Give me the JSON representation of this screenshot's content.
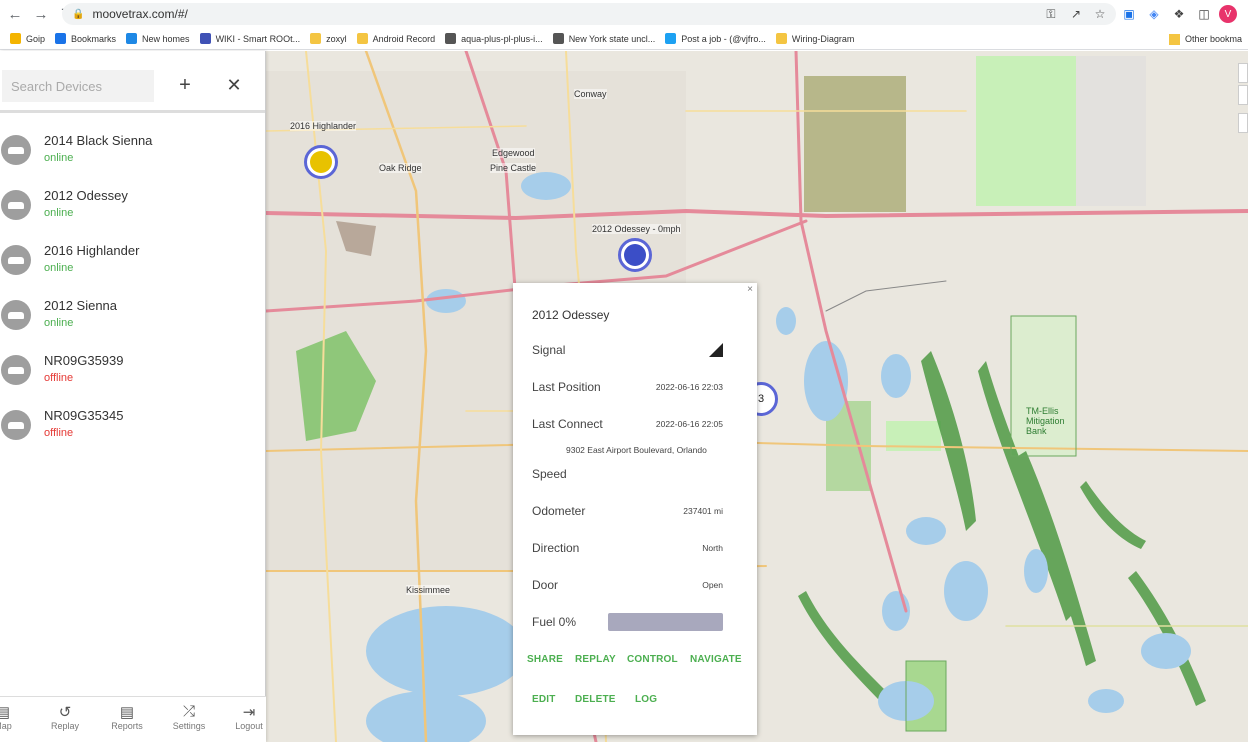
{
  "browser": {
    "url": "moovetrax.com/#/",
    "avatar_letter": "V",
    "bookmarks": [
      {
        "label": "Goip",
        "color": "#f4b400"
      },
      {
        "label": "Bookmarks",
        "color": "#1a73e8"
      },
      {
        "label": "New homes",
        "color": "#1e88e5"
      },
      {
        "label": "WIKI - Smart ROOt...",
        "color": "#3f51b5"
      },
      {
        "label": "zoxyl",
        "color": "#f4c542"
      },
      {
        "label": "Android Record",
        "color": "#f4c542"
      },
      {
        "label": "aqua-plus-pl-plus-i...",
        "color": "#555555"
      },
      {
        "label": "New York state uncl...",
        "color": "#555555"
      },
      {
        "label": "Post a job - (@vjfro...",
        "color": "#1da1f2"
      },
      {
        "label": "Wiring-Diagram",
        "color": "#f4c542"
      }
    ],
    "other_bookmarks": "Other bookma"
  },
  "sidebar": {
    "search_placeholder": "Search Devices",
    "devices": [
      {
        "name": "2014 Black Sienna",
        "status": "online"
      },
      {
        "name": "2012 Odessey",
        "status": "online"
      },
      {
        "name": "2016 Highlander",
        "status": "online"
      },
      {
        "name": "2012 Sienna",
        "status": "online"
      },
      {
        "name": "NR09G35939",
        "status": "offline"
      },
      {
        "name": "NR09G35345",
        "status": "offline"
      }
    ],
    "nav": [
      "Map",
      "Replay",
      "Reports",
      "Settings",
      "Logout"
    ]
  },
  "map": {
    "labels": {
      "highlander_marker": "2016 Highlander",
      "odessey_marker": "2012 Odessey - 0mph",
      "cluster_count": "3",
      "conway": "Conway",
      "oak_ridge": "Oak Ridge",
      "pine_castle": "Pine Castle",
      "kissimmee": "Kissimmee",
      "edgewood": "Edgewood",
      "tm_ellis": "TM-Ellis Mitigation Bank"
    }
  },
  "popup": {
    "title": "2012 Odessey",
    "signal_label": "Signal",
    "last_position_label": "Last Position",
    "last_position_value": "2022-06-16 22:03",
    "last_connect_label": "Last Connect",
    "last_connect_value": "2022-06-16 22:05",
    "address": "9302 East Airport Boulevard, Orlando",
    "speed_label": "Speed",
    "odometer_label": "Odometer",
    "odometer_value": "237401 mi",
    "direction_label": "Direction",
    "direction_value": "North",
    "door_label": "Door",
    "door_value": "Open",
    "fuel_label": "Fuel 0%",
    "fuel_level": 0,
    "actions_row1": [
      "SHARE",
      "REPLAY",
      "CONTROL",
      "NAVIGATE"
    ],
    "actions_row2": [
      "EDIT",
      "DELETE",
      "LOG"
    ],
    "close": "×"
  }
}
